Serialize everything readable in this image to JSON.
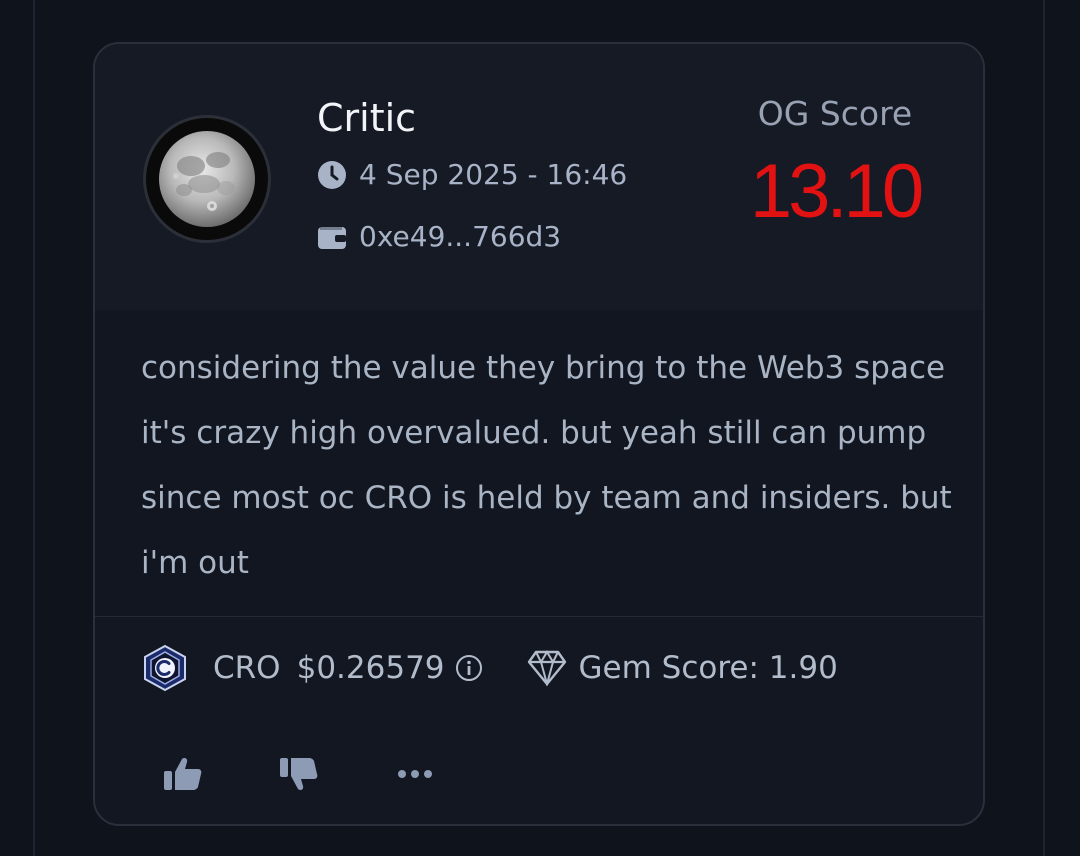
{
  "post": {
    "author": "Critic",
    "date": "4 Sep 2025 - 16:46",
    "wallet": "0xe49...766d3",
    "og_score_label": "OG Score",
    "og_score_value": "13.10",
    "text": "considering the value they bring to the Web3 space it's crazy high overvalued. but yeah still can pump since most oc CRO is held by team and insiders. but i'm out"
  },
  "token": {
    "symbol": "CRO",
    "price": "$0.26579",
    "gem_score": "Gem Score: 1.90"
  },
  "actions": {
    "like_icon": "thumbs-up-icon",
    "dislike_icon": "thumbs-down-icon",
    "more_icon": "more-dots-icon"
  },
  "colors": {
    "background": "#0f131b",
    "card": "#121722",
    "og_score": "#e21212",
    "text": "#a9b4c4"
  }
}
